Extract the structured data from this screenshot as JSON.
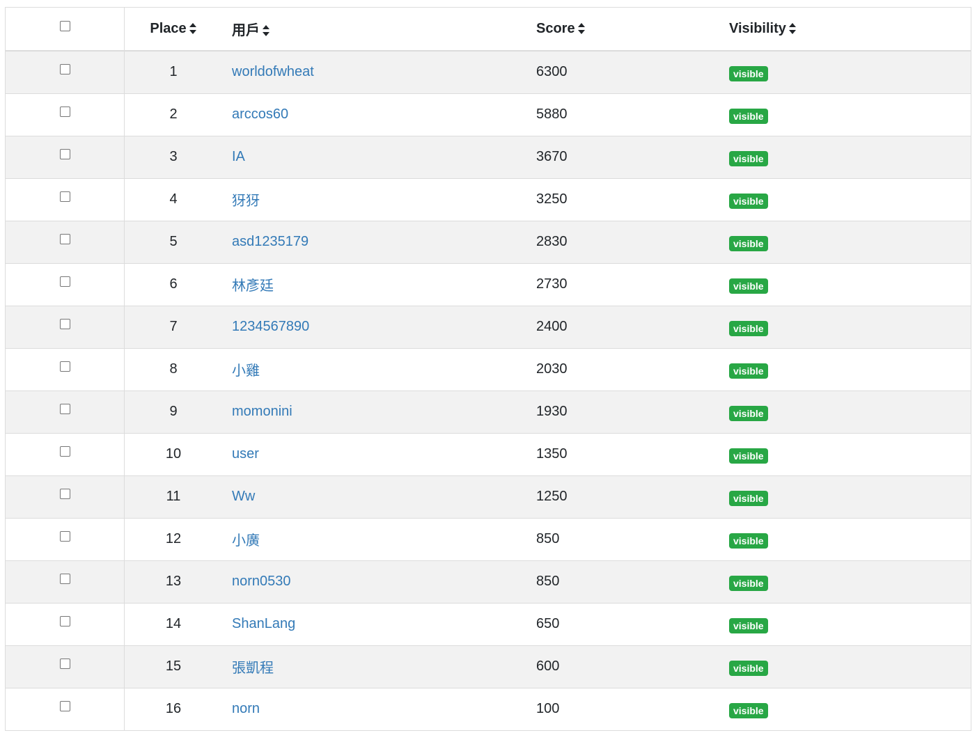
{
  "table": {
    "headers": {
      "place": "Place",
      "user": "用戶",
      "score": "Score",
      "visibility": "Visibility"
    },
    "icons": {
      "sort": "sort-icon",
      "checkbox": "checkbox"
    },
    "colors": {
      "link": "#337ab7",
      "badge": "#28a745",
      "stripe": "#f2f2f2"
    },
    "rows": [
      {
        "place": "1",
        "user": "worldofwheat",
        "score": "6300",
        "visibility": "visible"
      },
      {
        "place": "2",
        "user": "arccos60",
        "score": "5880",
        "visibility": "visible"
      },
      {
        "place": "3",
        "user": "IA",
        "score": "3670",
        "visibility": "visible"
      },
      {
        "place": "4",
        "user": "犽犽",
        "score": "3250",
        "visibility": "visible"
      },
      {
        "place": "5",
        "user": "asd1235179",
        "score": "2830",
        "visibility": "visible"
      },
      {
        "place": "6",
        "user": "林彥廷",
        "score": "2730",
        "visibility": "visible"
      },
      {
        "place": "7",
        "user": "1234567890",
        "score": "2400",
        "visibility": "visible"
      },
      {
        "place": "8",
        "user": "小雞",
        "score": "2030",
        "visibility": "visible"
      },
      {
        "place": "9",
        "user": "momonini",
        "score": "1930",
        "visibility": "visible"
      },
      {
        "place": "10",
        "user": "user",
        "score": "1350",
        "visibility": "visible"
      },
      {
        "place": "11",
        "user": "Ww",
        "score": "1250",
        "visibility": "visible"
      },
      {
        "place": "12",
        "user": "小廣",
        "score": "850",
        "visibility": "visible"
      },
      {
        "place": "13",
        "user": "norn0530",
        "score": "850",
        "visibility": "visible"
      },
      {
        "place": "14",
        "user": "ShanLang",
        "score": "650",
        "visibility": "visible"
      },
      {
        "place": "15",
        "user": "張凱程",
        "score": "600",
        "visibility": "visible"
      },
      {
        "place": "16",
        "user": "norn",
        "score": "100",
        "visibility": "visible"
      }
    ]
  }
}
